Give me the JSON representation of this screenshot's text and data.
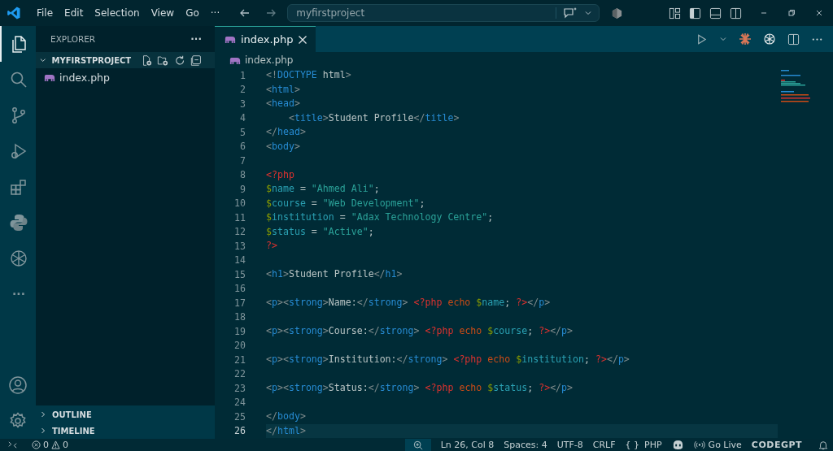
{
  "menu": [
    "File",
    "Edit",
    "Selection",
    "View",
    "Go",
    "···"
  ],
  "search": {
    "value": "myfirstproject"
  },
  "activity_bar": [
    {
      "kind": "files",
      "selected": true
    },
    {
      "kind": "search",
      "selected": false
    },
    {
      "kind": "branch",
      "selected": false
    },
    {
      "kind": "run",
      "selected": false
    },
    {
      "kind": "extensions",
      "selected": false
    },
    {
      "kind": "python",
      "selected": false
    },
    {
      "kind": "ai",
      "selected": false
    },
    {
      "kind": "more",
      "selected": false,
      "label": "···"
    }
  ],
  "sidebar": {
    "title": "EXPLORER",
    "more": "···",
    "folder": {
      "name": "MYFIRSTPROJECT",
      "expanded": true,
      "files": [
        "index.php"
      ]
    },
    "sections": [
      {
        "label": "OUTLINE",
        "expanded": false
      },
      {
        "label": "TIMELINE",
        "expanded": false
      }
    ]
  },
  "tabs": [
    {
      "label": "index.php",
      "selected": true
    }
  ],
  "breadcrumb": "index.php",
  "code": [
    {
      "number": "1",
      "current": false,
      "tokens": [
        {
          "kind": "punct",
          "text": "<!"
        },
        {
          "kind": "tag",
          "text": "DOCTYPE"
        },
        {
          "kind": "plain",
          "text": " html"
        },
        {
          "kind": "punct",
          "text": ">"
        }
      ]
    },
    {
      "number": "2",
      "current": false,
      "tokens": [
        {
          "kind": "punct",
          "text": "<"
        },
        {
          "kind": "tag",
          "text": "html"
        },
        {
          "kind": "punct",
          "text": ">"
        }
      ]
    },
    {
      "number": "3",
      "current": false,
      "tokens": [
        {
          "kind": "punct",
          "text": "<"
        },
        {
          "kind": "tag",
          "text": "head"
        },
        {
          "kind": "punct",
          "text": ">"
        }
      ]
    },
    {
      "number": "4",
      "current": false,
      "tokens": [
        {
          "kind": "punct",
          "text": "    <"
        },
        {
          "kind": "tag",
          "text": "title"
        },
        {
          "kind": "punct",
          "text": ">"
        },
        {
          "kind": "plain",
          "text": "Student Profile"
        },
        {
          "kind": "punct",
          "text": "</"
        },
        {
          "kind": "tag",
          "text": "title"
        },
        {
          "kind": "punct",
          "text": ">"
        }
      ]
    },
    {
      "number": "5",
      "current": false,
      "tokens": [
        {
          "kind": "punct",
          "text": "</"
        },
        {
          "kind": "tag",
          "text": "head"
        },
        {
          "kind": "punct",
          "text": ">"
        }
      ]
    },
    {
      "number": "6",
      "current": false,
      "tokens": [
        {
          "kind": "punct",
          "text": "<"
        },
        {
          "kind": "tag",
          "text": "body"
        },
        {
          "kind": "punct",
          "text": ">"
        }
      ]
    },
    {
      "number": "7",
      "current": false
    },
    {
      "number": "8",
      "current": false,
      "tokens": [
        {
          "kind": "php",
          "text": "<?php"
        }
      ]
    },
    {
      "number": "9",
      "current": false,
      "tokens": [
        {
          "kind": "dollar",
          "text": "$"
        },
        {
          "kind": "var",
          "text": "name"
        },
        {
          "kind": "plain",
          "text": " = "
        },
        {
          "kind": "string",
          "text": "\"Ahmed Ali\""
        },
        {
          "kind": "plain",
          "text": ";"
        }
      ]
    },
    {
      "number": "10",
      "current": false,
      "tokens": [
        {
          "kind": "dollar",
          "text": "$"
        },
        {
          "kind": "var",
          "text": "course"
        },
        {
          "kind": "plain",
          "text": " = "
        },
        {
          "kind": "string",
          "text": "\"Web Development\""
        },
        {
          "kind": "plain",
          "text": ";"
        }
      ]
    },
    {
      "number": "11",
      "current": false,
      "tokens": [
        {
          "kind": "dollar",
          "text": "$"
        },
        {
          "kind": "var",
          "text": "institution"
        },
        {
          "kind": "plain",
          "text": " = "
        },
        {
          "kind": "string",
          "text": "\"Adax Technology Centre\""
        },
        {
          "kind": "plain",
          "text": ";"
        }
      ]
    },
    {
      "number": "12",
      "current": false,
      "tokens": [
        {
          "kind": "dollar",
          "text": "$"
        },
        {
          "kind": "var",
          "text": "status"
        },
        {
          "kind": "plain",
          "text": " = "
        },
        {
          "kind": "string",
          "text": "\"Active\""
        },
        {
          "kind": "plain",
          "text": ";"
        }
      ]
    },
    {
      "number": "13",
      "current": false,
      "tokens": [
        {
          "kind": "php",
          "text": "?>"
        }
      ]
    },
    {
      "number": "14",
      "current": false
    },
    {
      "number": "15",
      "current": false,
      "tokens": [
        {
          "kind": "punct",
          "text": "<"
        },
        {
          "kind": "tag",
          "text": "h1"
        },
        {
          "kind": "punct",
          "text": ">"
        },
        {
          "kind": "plain",
          "text": "Student Profile"
        },
        {
          "kind": "punct",
          "text": "</"
        },
        {
          "kind": "tag",
          "text": "h1"
        },
        {
          "kind": "punct",
          "text": ">"
        }
      ]
    },
    {
      "number": "16",
      "current": false
    },
    {
      "number": "17",
      "current": false,
      "tokens": [
        {
          "kind": "punct",
          "text": "<"
        },
        {
          "kind": "tag",
          "text": "p"
        },
        {
          "kind": "punct",
          "text": "><"
        },
        {
          "kind": "tag",
          "text": "strong"
        },
        {
          "kind": "punct",
          "text": ">"
        },
        {
          "kind": "plain",
          "text": "Name:"
        },
        {
          "kind": "punct",
          "text": "</"
        },
        {
          "kind": "tag",
          "text": "strong"
        },
        {
          "kind": "punct",
          "text": "> "
        },
        {
          "kind": "php",
          "text": "<?php"
        },
        {
          "kind": "keyword",
          "text": " echo "
        },
        {
          "kind": "dollar",
          "text": "$"
        },
        {
          "kind": "var",
          "text": "name"
        },
        {
          "kind": "plain",
          "text": "; "
        },
        {
          "kind": "php",
          "text": "?>"
        },
        {
          "kind": "punct",
          "text": "</"
        },
        {
          "kind": "tag",
          "text": "p"
        },
        {
          "kind": "punct",
          "text": ">"
        }
      ]
    },
    {
      "number": "18",
      "current": false
    },
    {
      "number": "19",
      "current": false,
      "tokens": [
        {
          "kind": "punct",
          "text": "<"
        },
        {
          "kind": "tag",
          "text": "p"
        },
        {
          "kind": "punct",
          "text": "><"
        },
        {
          "kind": "tag",
          "text": "strong"
        },
        {
          "kind": "punct",
          "text": ">"
        },
        {
          "kind": "plain",
          "text": "Course:"
        },
        {
          "kind": "punct",
          "text": "</"
        },
        {
          "kind": "tag",
          "text": "strong"
        },
        {
          "kind": "punct",
          "text": "> "
        },
        {
          "kind": "php",
          "text": "<?php"
        },
        {
          "kind": "keyword",
          "text": " echo "
        },
        {
          "kind": "dollar",
          "text": "$"
        },
        {
          "kind": "var",
          "text": "course"
        },
        {
          "kind": "plain",
          "text": "; "
        },
        {
          "kind": "php",
          "text": "?>"
        },
        {
          "kind": "punct",
          "text": "</"
        },
        {
          "kind": "tag",
          "text": "p"
        },
        {
          "kind": "punct",
          "text": ">"
        }
      ]
    },
    {
      "number": "20",
      "current": false
    },
    {
      "number": "21",
      "current": false,
      "tokens": [
        {
          "kind": "punct",
          "text": "<"
        },
        {
          "kind": "tag",
          "text": "p"
        },
        {
          "kind": "punct",
          "text": "><"
        },
        {
          "kind": "tag",
          "text": "strong"
        },
        {
          "kind": "punct",
          "text": ">"
        },
        {
          "kind": "plain",
          "text": "Institution:"
        },
        {
          "kind": "punct",
          "text": "</"
        },
        {
          "kind": "tag",
          "text": "strong"
        },
        {
          "kind": "punct",
          "text": "> "
        },
        {
          "kind": "php",
          "text": "<?php"
        },
        {
          "kind": "keyword",
          "text": " echo "
        },
        {
          "kind": "dollar",
          "text": "$"
        },
        {
          "kind": "var",
          "text": "institution"
        },
        {
          "kind": "plain",
          "text": "; "
        },
        {
          "kind": "php",
          "text": "?>"
        },
        {
          "kind": "punct",
          "text": "</"
        },
        {
          "kind": "tag",
          "text": "p"
        },
        {
          "kind": "punct",
          "text": ">"
        }
      ]
    },
    {
      "number": "22",
      "current": false
    },
    {
      "number": "23",
      "current": false,
      "tokens": [
        {
          "kind": "punct",
          "text": "<"
        },
        {
          "kind": "tag",
          "text": "p"
        },
        {
          "kind": "punct",
          "text": "><"
        },
        {
          "kind": "tag",
          "text": "strong"
        },
        {
          "kind": "punct",
          "text": ">"
        },
        {
          "kind": "plain",
          "text": "Status:"
        },
        {
          "kind": "punct",
          "text": "</"
        },
        {
          "kind": "tag",
          "text": "strong"
        },
        {
          "kind": "punct",
          "text": "> "
        },
        {
          "kind": "php",
          "text": "<?php"
        },
        {
          "kind": "keyword",
          "text": " echo "
        },
        {
          "kind": "dollar",
          "text": "$"
        },
        {
          "kind": "var",
          "text": "status"
        },
        {
          "kind": "plain",
          "text": "; "
        },
        {
          "kind": "php",
          "text": "?>"
        },
        {
          "kind": "punct",
          "text": "</"
        },
        {
          "kind": "tag",
          "text": "p"
        },
        {
          "kind": "punct",
          "text": ">"
        }
      ]
    },
    {
      "number": "24",
      "current": false
    },
    {
      "number": "25",
      "current": false,
      "tokens": [
        {
          "kind": "punct",
          "text": "</"
        },
        {
          "kind": "tag",
          "text": "body"
        },
        {
          "kind": "punct",
          "text": ">"
        }
      ]
    },
    {
      "number": "26",
      "current": true,
      "tokens": [
        {
          "kind": "punct",
          "text": "</"
        },
        {
          "kind": "tag",
          "text": "html"
        },
        {
          "kind": "punct",
          "text": ">"
        }
      ]
    }
  ],
  "status_bar": {
    "errors": "0",
    "warnings": "0",
    "position": "Ln 26, Col 8",
    "indent": "Spaces: 4",
    "encoding": "UTF-8",
    "eol": "CRLF",
    "language_braces": "{ }",
    "language": "PHP",
    "live": "Go Live",
    "brand": "CODEGPT"
  }
}
